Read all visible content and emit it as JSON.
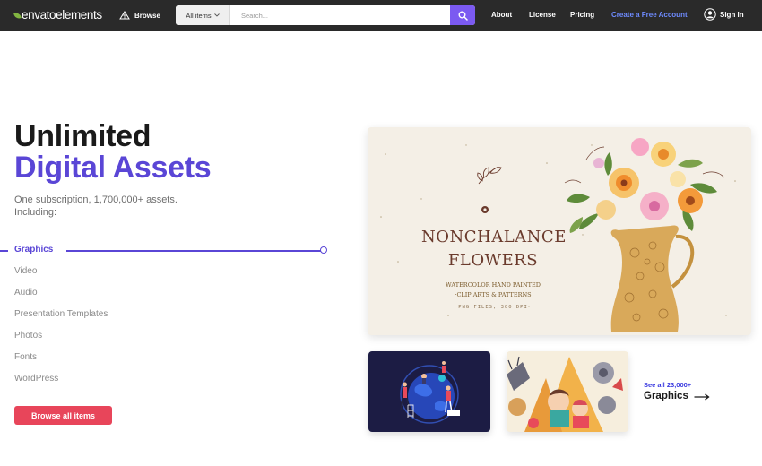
{
  "nav": {
    "logo": "envatoelements",
    "browse_label": "Browse",
    "search": {
      "category": "All items",
      "placeholder": "Search..."
    },
    "links": [
      "About",
      "License",
      "Pricing"
    ],
    "cta": "Create a Free Account",
    "signin": "Sign In",
    "colors": {
      "background": "#2a2a2a",
      "search_button": "#7b5af1",
      "cta": "#6e8bff"
    }
  },
  "hero": {
    "headline_line1": "Unlimited",
    "headline_line2": "Digital Assets",
    "subtext": "One subscription, 1,700,000+ assets. Including:",
    "categories": [
      "Graphics",
      "Video",
      "Audio",
      "Presentation Templates",
      "Photos",
      "Fonts",
      "WordPress"
    ],
    "active_category": "Graphics",
    "browse_button": "Browse all items",
    "colors": {
      "accent": "#5a46d6",
      "button": "#e8455a"
    }
  },
  "showcase": {
    "feature": {
      "title_line1": "NONCHALANCE",
      "title_line2": "FLOWERS",
      "subtitle_line1": "WATERCOLOR HAND PAINTED",
      "subtitle_line2": "·CLIP ARTS & PATTERNS",
      "meta": "PNG FILES, 300 DPI"
    },
    "see_all": {
      "small": "See all 23,000+",
      "big": "Graphics"
    }
  }
}
